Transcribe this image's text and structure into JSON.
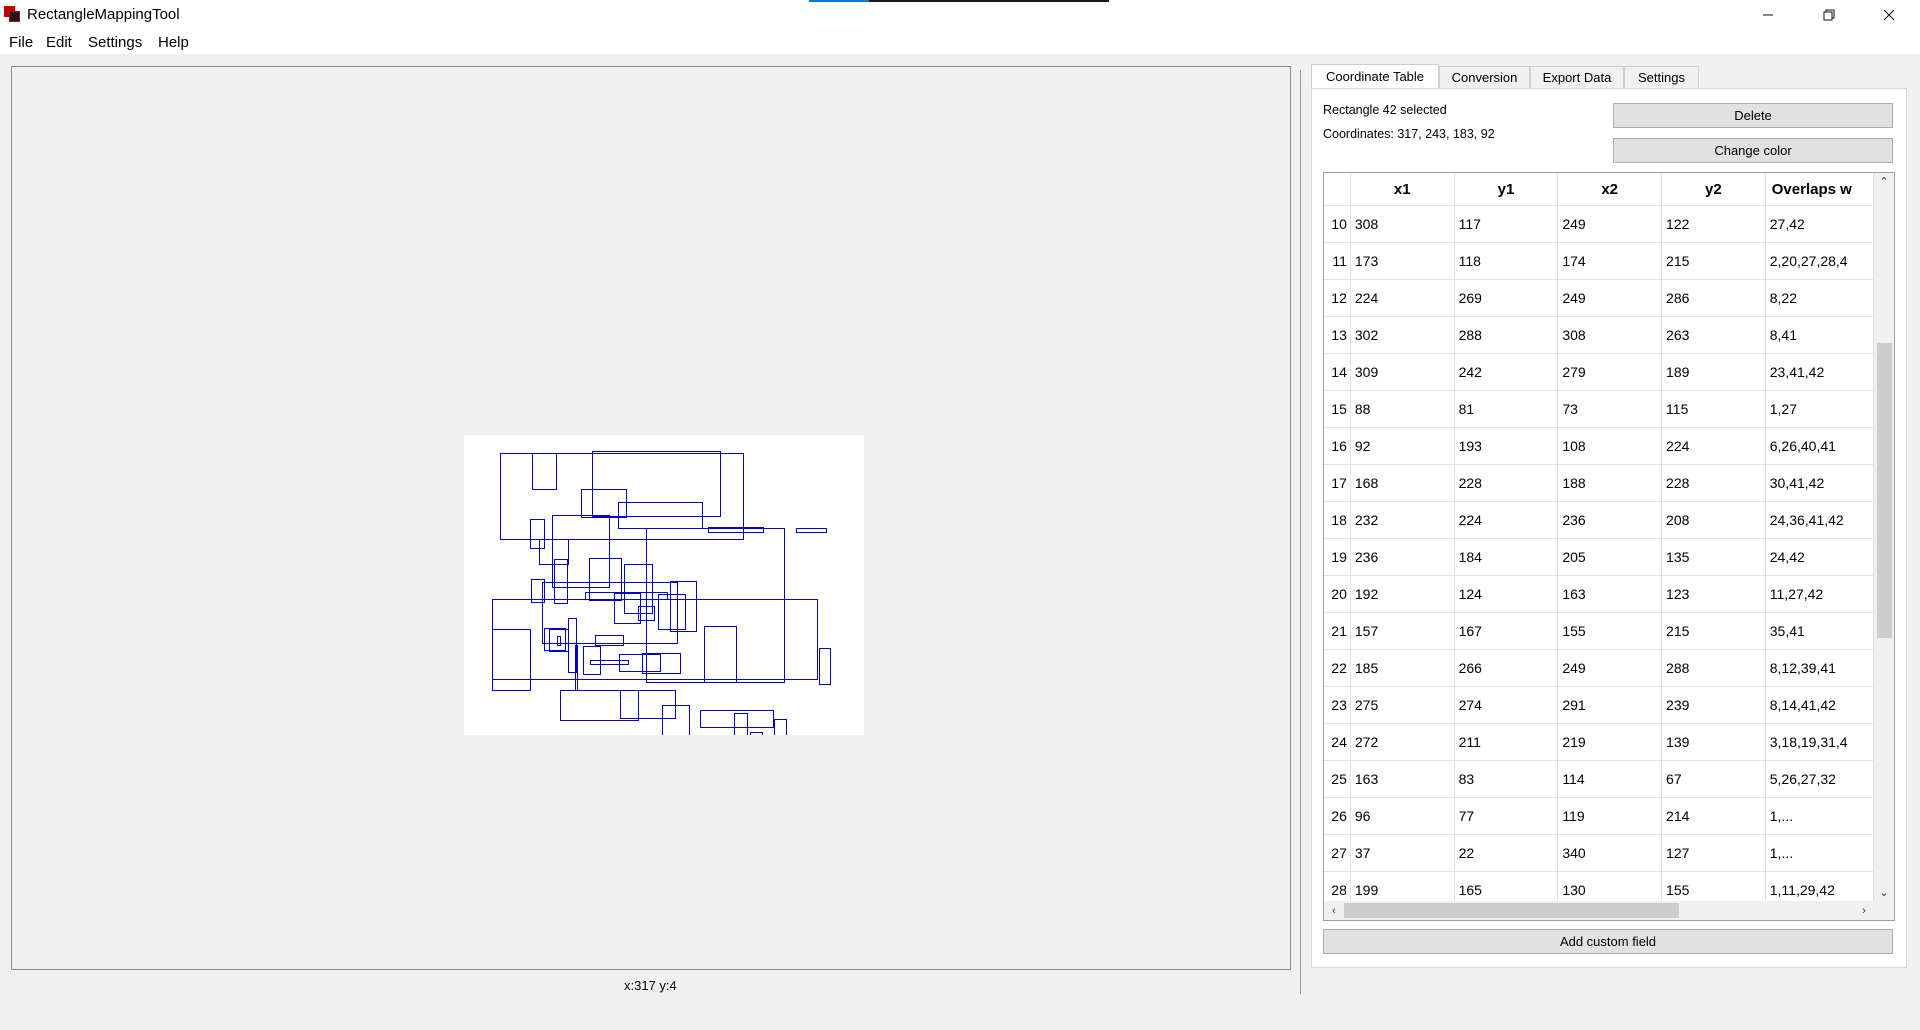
{
  "window": {
    "title": "RectangleMappingTool",
    "minimize_glyph": "─",
    "maximize_glyph": "❐",
    "close_glyph": "✕"
  },
  "menu": [
    "File",
    "Edit",
    "Settings",
    "Help"
  ],
  "canvas": {
    "cursor_readout": "x:317 y:4",
    "rect_color": "#0000cc",
    "rects": [
      [
        36,
        18,
        279,
        104
      ],
      [
        128,
        16,
        256,
        81
      ],
      [
        68,
        18,
        92,
        54
      ],
      [
        117,
        54,
        162,
        82
      ],
      [
        66,
        84,
        80,
        113
      ],
      [
        154,
        67,
        238,
        93
      ],
      [
        88,
        80,
        145,
        152
      ],
      [
        244,
        92,
        299,
        97
      ],
      [
        332,
        93,
        362,
        97
      ],
      [
        75,
        104,
        104,
        129
      ],
      [
        182,
        93,
        320,
        247
      ],
      [
        67,
        144,
        80,
        167
      ],
      [
        125,
        123,
        157,
        165
      ],
      [
        90,
        124,
        103,
        168
      ],
      [
        78,
        147,
        213,
        208
      ],
      [
        160,
        129,
        188,
        178
      ],
      [
        194,
        159,
        221,
        194
      ],
      [
        206,
        146,
        232,
        196
      ],
      [
        28,
        164,
        353,
        244
      ],
      [
        121,
        157,
        203,
        164
      ],
      [
        240,
        191,
        272,
        247
      ],
      [
        28,
        194,
        66,
        255
      ],
      [
        93,
        201,
        96,
        210
      ],
      [
        104,
        183,
        112,
        237
      ],
      [
        150,
        158,
        176,
        188
      ],
      [
        131,
        200,
        159,
        210
      ],
      [
        111,
        210,
        113,
        255
      ],
      [
        178,
        218,
        216,
        238
      ],
      [
        174,
        171,
        190,
        185
      ],
      [
        80,
        193,
        101,
        215
      ],
      [
        85,
        194,
        104,
        216
      ],
      [
        126,
        225,
        164,
        229
      ],
      [
        119,
        211,
        136,
        239
      ],
      [
        155,
        219,
        196,
        236
      ],
      [
        355,
        213,
        366,
        249
      ],
      [
        96,
        255,
        174,
        285
      ],
      [
        156,
        255,
        211,
        283
      ],
      [
        198,
        270,
        225,
        300
      ],
      [
        236,
        275,
        309,
        292
      ],
      [
        270,
        278,
        283,
        309
      ],
      [
        286,
        297,
        298,
        300
      ],
      [
        310,
        284,
        322,
        310
      ]
    ]
  },
  "right_panel": {
    "tabs": [
      "Coordinate Table",
      "Conversion",
      "Export Data",
      "Settings"
    ],
    "active_tab": 0,
    "selection_text": "Rectangle 42 selected",
    "coordinates_text": "Coordinates: 317, 243, 183, 92",
    "delete_label": "Delete",
    "change_color_label": "Change color",
    "add_field_label": "Add custom field",
    "table": {
      "columns": [
        "x1",
        "y1",
        "x2",
        "y2",
        "Overlaps w"
      ],
      "rows": [
        [
          "10",
          "308",
          "117",
          "249",
          "122",
          "27,42"
        ],
        [
          "11",
          "173",
          "118",
          "174",
          "215",
          "2,20,27,28,4"
        ],
        [
          "12",
          "224",
          "269",
          "249",
          "286",
          "8,22"
        ],
        [
          "13",
          "302",
          "288",
          "308",
          "263",
          "8,41"
        ],
        [
          "14",
          "309",
          "242",
          "279",
          "189",
          "23,41,42"
        ],
        [
          "15",
          "88",
          "81",
          "73",
          "115",
          "1,27"
        ],
        [
          "16",
          "92",
          "193",
          "108",
          "224",
          "6,26,40,41"
        ],
        [
          "17",
          "168",
          "228",
          "188",
          "228",
          "30,41,42"
        ],
        [
          "18",
          "232",
          "224",
          "236",
          "208",
          "24,36,41,42"
        ],
        [
          "19",
          "236",
          "184",
          "205",
          "135",
          "24,42"
        ],
        [
          "20",
          "192",
          "124",
          "163",
          "123",
          "11,27,42"
        ],
        [
          "21",
          "157",
          "167",
          "155",
          "215",
          "35,41"
        ],
        [
          "22",
          "185",
          "266",
          "249",
          "288",
          "8,12,39,41"
        ],
        [
          "23",
          "275",
          "274",
          "291",
          "239",
          "8,14,41,42"
        ],
        [
          "24",
          "272",
          "211",
          "219",
          "139",
          "3,18,19,31,4"
        ],
        [
          "25",
          "163",
          "83",
          "114",
          "67",
          "5,26,27,32"
        ],
        [
          "26",
          "96",
          "77",
          "119",
          "214",
          "1,..."
        ],
        [
          "27",
          "37",
          "22",
          "340",
          "127",
          "1,..."
        ],
        [
          "28",
          "199",
          "165",
          "130",
          "155",
          "1,11,29,42"
        ]
      ]
    }
  }
}
